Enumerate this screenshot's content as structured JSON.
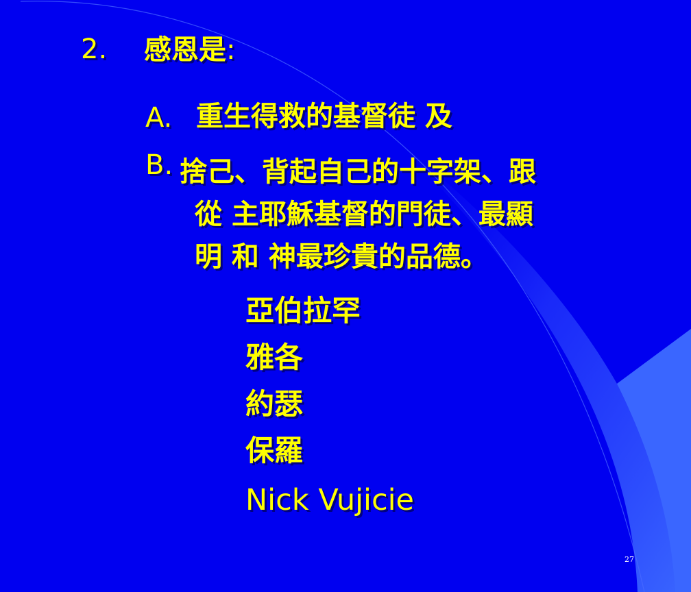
{
  "slide": {
    "number_label": "2.",
    "heading": "感恩是",
    "heading_colon": ":",
    "item_a_label": "A.",
    "item_a_text": "重生得救的基督徒 及",
    "item_b_label": "B.",
    "item_b_line1": "捨己、背起自己的十字架、跟",
    "item_b_line2": "從 主耶穌基督的門徒、最顯",
    "item_b_line3": "明 和 神最珍貴的品德。",
    "examples": [
      "亞伯拉罕",
      "雅各",
      "約瑟",
      "保羅"
    ],
    "example_en": "Nick Vujicie",
    "page_number": "27"
  },
  "colors": {
    "background": "#0000f0",
    "text": "#ffff00",
    "decoration_light": "#3a66ff"
  }
}
